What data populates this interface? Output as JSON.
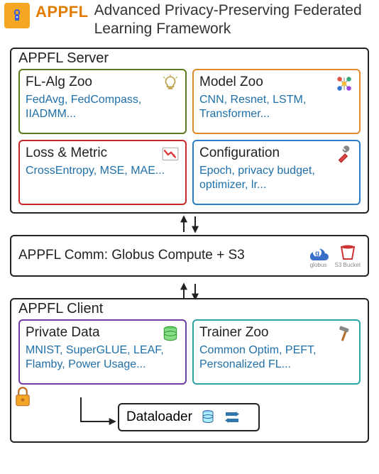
{
  "header": {
    "brand": "APPFL",
    "tagline": "Advanced Privacy-Preserving Federated Learning Framework"
  },
  "server": {
    "title": "APPFL Server",
    "cards": {
      "flalg": {
        "title": "FL-Alg Zoo",
        "body": "FedAvg, FedCompass, IIADMM..."
      },
      "model": {
        "title": "Model Zoo",
        "body": "CNN, Resnet, LSTM, Transformer..."
      },
      "loss": {
        "title": "Loss & Metric",
        "body": "CrossEntropy, MSE, MAE..."
      },
      "config": {
        "title": "Configuration",
        "body": "Epoch, privacy budget, optimizer, lr..."
      }
    }
  },
  "comm": {
    "text": "APPFL Comm: Globus Compute + S3",
    "globus_label": "globus",
    "s3_label": "S3 Bucket"
  },
  "client": {
    "title": "APPFL Client",
    "cards": {
      "data": {
        "title": "Private Data",
        "body": "MNIST, SuperGLUE, LEAF, Flamby, Power Usage..."
      },
      "trainer": {
        "title": "Trainer Zoo",
        "body": "Common Optim, PEFT, Personalized FL..."
      }
    },
    "dataloader": "Dataloader"
  },
  "colors": {
    "flalg": "#5a7a1f",
    "model": "#e08a2a",
    "loss": "#c62828",
    "config": "#2a7fc6",
    "data": "#6a3fa0",
    "trainer": "#2aa6a6"
  }
}
